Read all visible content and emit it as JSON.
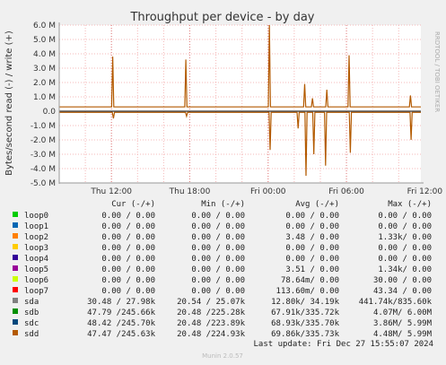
{
  "side_text": "RRDTOOL / TOBI OETIKER",
  "footer": "Munin 2.0.57",
  "last_update": "Last update: Fri Dec 27 15:55:07 2024",
  "chart_data": {
    "type": "line",
    "title": "Throughput per device - by day",
    "ylabel": "Bytes/second read (-) / write (+)",
    "xlabel": "",
    "ylim": [
      -5000000,
      6000000
    ],
    "y_ticks": [
      6000000,
      5000000,
      4000000,
      3000000,
      2000000,
      1000000,
      0,
      -1000000,
      -2000000,
      -3000000,
      -4000000,
      -5000000
    ],
    "y_tick_labels": [
      "6.0 M",
      "5.0 M",
      "4.0 M",
      "3.0 M",
      "2.0 M",
      "1.0 M",
      "0.0",
      "-1.0 M",
      "-2.0 M",
      "-3.0 M",
      "-4.0 M",
      "-5.0 M"
    ],
    "x_range_hours": [
      8,
      35.7
    ],
    "x_ticks": [
      12,
      18,
      24,
      30,
      36
    ],
    "x_tick_labels": [
      "Thu 12:00",
      "Thu 18:00",
      "Fri 00:00",
      "Fri 06:00",
      "Fri 12:00"
    ],
    "grid": true,
    "legend_headers": [
      "Cur (-/+)",
      "Min (-/+)",
      "Avg (-/+)",
      "Max (-/+)"
    ],
    "legend": [
      {
        "name": "loop0",
        "color": "#00cc00",
        "cur": "0.00 /  0.00",
        "min": "0.00 /  0.00",
        "avg": "0.00 /  0.00",
        "max": "0.00 /  0.00"
      },
      {
        "name": "loop1",
        "color": "#0066b3",
        "cur": "0.00 /  0.00",
        "min": "0.00 /  0.00",
        "avg": "0.00 /  0.00",
        "max": "0.00 /  0.00"
      },
      {
        "name": "loop2",
        "color": "#ff8000",
        "cur": "0.00 /  0.00",
        "min": "0.00 /  0.00",
        "avg": "3.48 /  0.00",
        "max": "1.33k/  0.00"
      },
      {
        "name": "loop3",
        "color": "#ffcc00",
        "cur": "0.00 /  0.00",
        "min": "0.00 /  0.00",
        "avg": "0.00 /  0.00",
        "max": "0.00 /  0.00"
      },
      {
        "name": "loop4",
        "color": "#330099",
        "cur": "0.00 /  0.00",
        "min": "0.00 /  0.00",
        "avg": "0.00 /  0.00",
        "max": "0.00 /  0.00"
      },
      {
        "name": "loop5",
        "color": "#990099",
        "cur": "0.00 /  0.00",
        "min": "0.00 /  0.00",
        "avg": "3.51 /  0.00",
        "max": "1.34k/  0.00"
      },
      {
        "name": "loop6",
        "color": "#ccff00",
        "cur": "0.00 /  0.00",
        "min": "0.00 /  0.00",
        "avg": "78.64m/  0.00",
        "max": "30.00 /  0.00"
      },
      {
        "name": "loop7",
        "color": "#ff0000",
        "cur": "0.00 /  0.00",
        "min": "0.00 /  0.00",
        "avg": "113.60m/  0.00",
        "max": "43.34 /  0.00"
      },
      {
        "name": "sda",
        "color": "#808080",
        "cur": "30.48 / 27.98k",
        "min": "20.54 / 25.07k",
        "avg": "12.80k/ 34.19k",
        "max": "441.74k/835.60k"
      },
      {
        "name": "sdb",
        "color": "#008f00",
        "cur": "47.79 /245.66k",
        "min": "20.48 /225.28k",
        "avg": "67.91k/335.72k",
        "max": "4.07M/  6.00M"
      },
      {
        "name": "sdc",
        "color": "#00487d",
        "cur": "48.42 /245.70k",
        "min": "20.48 /223.89k",
        "avg": "68.93k/335.70k",
        "max": "3.86M/  5.99M"
      },
      {
        "name": "sdd",
        "color": "#b35a00",
        "cur": "47.47 /245.63k",
        "min": "20.48 /224.93k",
        "avg": "69.86k/335.73k",
        "max": "4.48M/  5.99M"
      }
    ],
    "series": [
      {
        "name": "sdd",
        "color": "#b35a00",
        "baseline_write": 300000,
        "baseline_read": -80000,
        "spikes": [
          [
            12.1,
            3800000
          ],
          [
            12.15,
            -500000
          ],
          [
            17.7,
            3600000
          ],
          [
            17.75,
            -350000
          ],
          [
            24.1,
            6000000
          ],
          [
            24.15,
            -2700000
          ],
          [
            26.3,
            -1200000
          ],
          [
            26.8,
            1900000
          ],
          [
            26.9,
            -4500000
          ],
          [
            27.4,
            900000
          ],
          [
            27.5,
            -3000000
          ],
          [
            28.4,
            -3800000
          ],
          [
            28.5,
            1500000
          ],
          [
            30.2,
            3900000
          ],
          [
            30.3,
            -2900000
          ],
          [
            34.9,
            1100000
          ],
          [
            34.95,
            -2000000
          ]
        ]
      }
    ]
  }
}
